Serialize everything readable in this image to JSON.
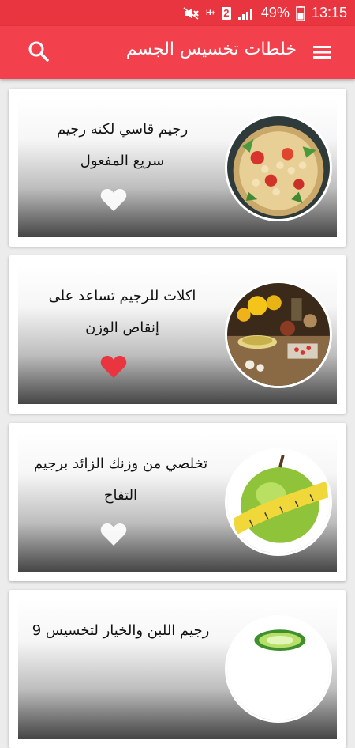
{
  "status_bar": {
    "mute_icon": "mute-icon",
    "network_type": "H+",
    "sim_slot": "2",
    "signal_icon": "signal-icon",
    "battery_percent": "49%",
    "battery_icon": "battery-icon",
    "time": "13:15"
  },
  "app_bar": {
    "title": "خلطات تخسيس الجسم",
    "menu_icon": "menu-icon",
    "search_icon": "search-icon"
  },
  "colors": {
    "status_bar": "#e8353f",
    "app_bar": "#f2404c",
    "heart_active": "#e8353f",
    "heart_inactive": "#ffffff"
  },
  "articles": [
    {
      "title_line1": "رجيم قاسي لكنه رجيم",
      "title_line2": "سريع المفعول",
      "favorite": false,
      "image": "chickpea-salad"
    },
    {
      "title_line1": "اكلات للرجيم تساعد على",
      "title_line2": "إنقاص الوزن",
      "favorite": true,
      "image": "diet-food"
    },
    {
      "title_line1": "تخلصي من وزنك الزائد برجيم",
      "title_line2": "التفاح",
      "favorite": false,
      "image": "apple-tape-measure"
    },
    {
      "title_line1": "رجيم اللبن والخيار لتخسيس 9",
      "title_line2": "",
      "favorite": false,
      "image": "cucumber"
    }
  ]
}
